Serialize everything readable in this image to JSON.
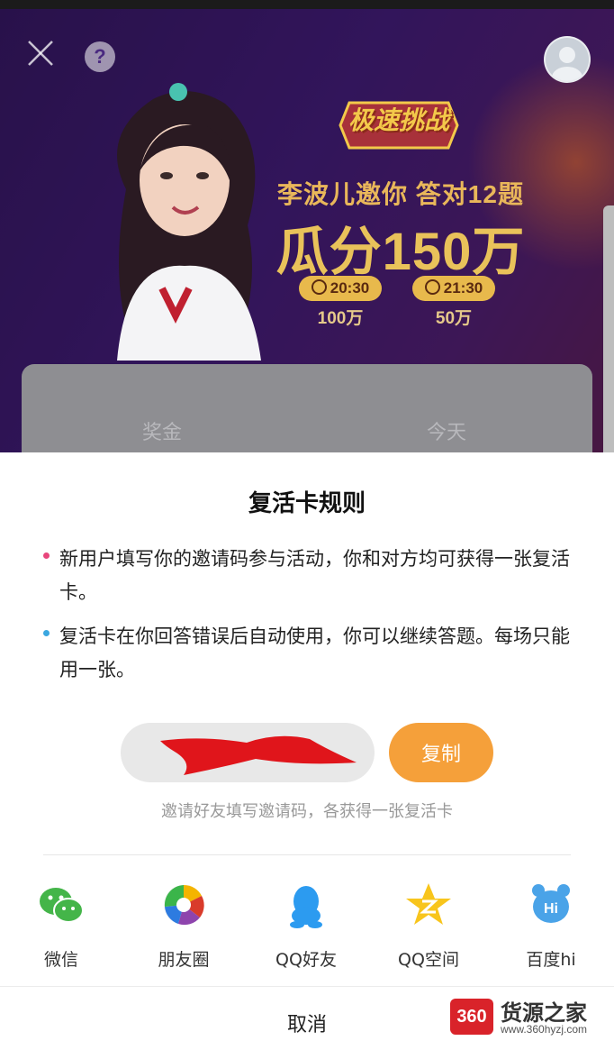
{
  "banner": {
    "badge_text": "极速挑战",
    "headline": "李波儿邀你 答对12题",
    "amount": "瓜分150万",
    "sessions": [
      {
        "time": "20:30",
        "prize": "100万"
      },
      {
        "time": "21:30",
        "prize": "50万"
      }
    ],
    "card_labels": [
      "奖金",
      "今天"
    ]
  },
  "sheet": {
    "title": "复活卡规则",
    "rules": [
      {
        "text": "新用户填写你的邀请码参与活动，你和对方均可获得一张复活卡。",
        "dot_color": "#e8467c"
      },
      {
        "text": "复活卡在你回答错误后自动使用，你可以继续答题。每场只能用一张。",
        "dot_color": "#3aa7e0"
      }
    ],
    "copy_label": "复制",
    "hint": "邀请好友填写邀请码，各获得一张复活卡",
    "share_targets": [
      {
        "label": "微信",
        "icon": "wechat-icon"
      },
      {
        "label": "朋友圈",
        "icon": "moments-icon"
      },
      {
        "label": "QQ好友",
        "icon": "qq-icon"
      },
      {
        "label": "QQ空间",
        "icon": "qzone-icon"
      },
      {
        "label": "百度hi",
        "icon": "baidu-hi-icon"
      }
    ],
    "cancel_label": "取消"
  },
  "watermark": {
    "badge": "360",
    "name": "货源之家",
    "url": "www.360hyzj.com"
  },
  "colors": {
    "accent_orange": "#f5a03a",
    "banner_purple": "#4a1f86",
    "gold_text": "#e9c25a"
  }
}
